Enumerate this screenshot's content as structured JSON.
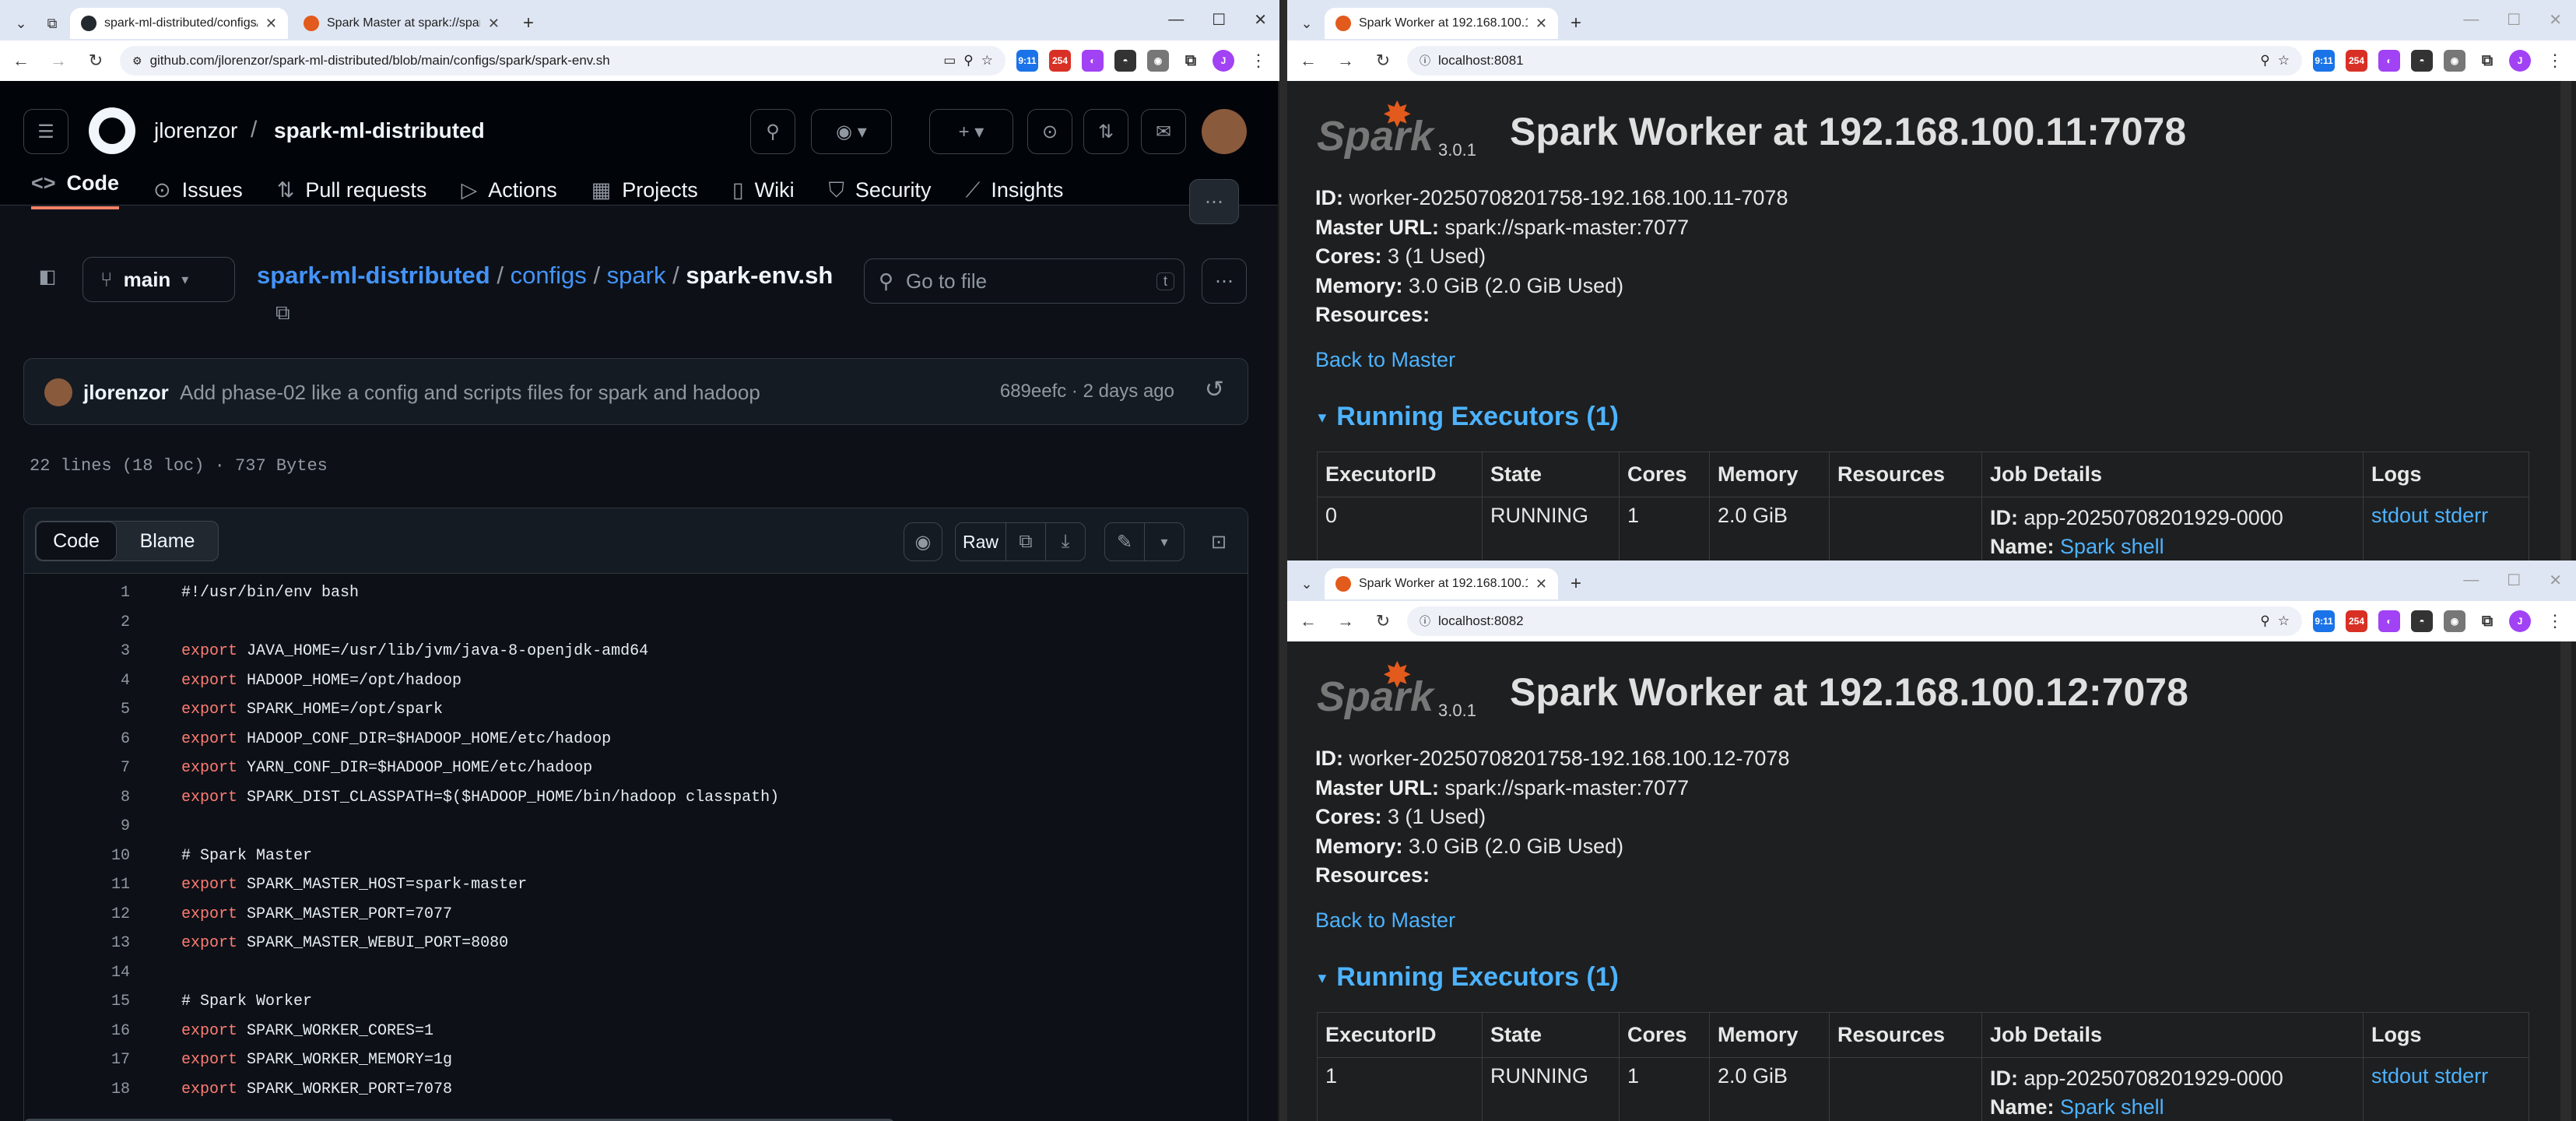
{
  "left_window": {
    "tabs": [
      {
        "title": "spark-ml-distributed/configs/sp",
        "active": true
      },
      {
        "title": "Spark Master at spark://spark-m",
        "active": false
      }
    ],
    "url": "github.com/jlorenzor/spark-ml-distributed/blob/main/configs/spark/spark-env.sh"
  },
  "github": {
    "owner": "jlorenzor",
    "repo": "spark-ml-distributed",
    "nav": [
      "Code",
      "Issues",
      "Pull requests",
      "Actions",
      "Projects",
      "Wiki",
      "Security",
      "Insights"
    ],
    "branch": "main",
    "breadcrumb": {
      "repo": "spark-ml-distributed",
      "dir1": "configs",
      "dir2": "spark",
      "file": "spark-env.sh"
    },
    "goto_placeholder": "Go to file",
    "goto_key": "t",
    "commit": {
      "author": "jlorenzor",
      "message": "Add phase-02 like a config and scripts files for spark and hadoop",
      "hash_time": "689eefc · 2 days ago"
    },
    "file_meta": "22 lines (18 loc) · 737 Bytes",
    "view_tabs": {
      "code": "Code",
      "blame": "Blame",
      "raw": "Raw"
    },
    "code_lines": [
      {
        "n": "1",
        "kw": "",
        "rest": "#!/usr/bin/env bash",
        "cls": "ct"
      },
      {
        "n": "2",
        "kw": "",
        "rest": "",
        "cls": "ct"
      },
      {
        "n": "3",
        "kw": "export",
        "rest": " JAVA_HOME=/usr/lib/jvm/java-8-openjdk-amd64",
        "cls": "ct"
      },
      {
        "n": "4",
        "kw": "export",
        "rest": " HADOOP_HOME=/opt/hadoop",
        "cls": "ct"
      },
      {
        "n": "5",
        "kw": "export",
        "rest": " SPARK_HOME=/opt/spark",
        "cls": "ct"
      },
      {
        "n": "6",
        "kw": "export",
        "rest": " HADOOP_CONF_DIR=$HADOOP_HOME/etc/hadoop",
        "cls": "ct"
      },
      {
        "n": "7",
        "kw": "export",
        "rest": " YARN_CONF_DIR=$HADOOP_HOME/etc/hadoop",
        "cls": "ct"
      },
      {
        "n": "8",
        "kw": "export",
        "rest": " SPARK_DIST_CLASSPATH=$($HADOOP_HOME/bin/hadoop classpath)",
        "cls": "ct"
      },
      {
        "n": "9",
        "kw": "",
        "rest": "",
        "cls": "ct"
      },
      {
        "n": "10",
        "kw": "",
        "rest": "# Spark Master",
        "cls": "ct cm"
      },
      {
        "n": "11",
        "kw": "export",
        "rest": " SPARK_MASTER_HOST=spark-master",
        "cls": "ct"
      },
      {
        "n": "12",
        "kw": "export",
        "rest": " SPARK_MASTER_PORT=7077",
        "cls": "ct"
      },
      {
        "n": "13",
        "kw": "export",
        "rest": " SPARK_MASTER_WEBUI_PORT=8080",
        "cls": "ct"
      },
      {
        "n": "14",
        "kw": "",
        "rest": "",
        "cls": "ct"
      },
      {
        "n": "15",
        "kw": "",
        "rest": "# Spark Worker",
        "cls": "ct cm"
      },
      {
        "n": "16",
        "kw": "export",
        "rest": " SPARK_WORKER_CORES=1",
        "cls": "ct"
      },
      {
        "n": "17",
        "kw": "export",
        "rest": " SPARK_WORKER_MEMORY=1g",
        "cls": "ct"
      },
      {
        "n": "18",
        "kw": "export",
        "rest": " SPARK_WORKER_PORT=7078",
        "cls": "ct"
      }
    ]
  },
  "workers": [
    {
      "tab_title": "Spark Worker at 192.168.100.1",
      "url": "localhost:8081",
      "spark_version": "3.0.1",
      "title": "Spark Worker at 192.168.100.11:7078",
      "id_label": "ID:",
      "id": " worker-20250708201758-192.168.100.11-7078",
      "master_label": "Master URL:",
      "master": " spark://spark-master:7077",
      "cores_label": "Cores:",
      "cores": " 3 (1 Used)",
      "memory_label": "Memory:",
      "memory": " 3.0 GiB (2.0 GiB Used)",
      "resources_label": "Resources:",
      "back": "Back to Master",
      "running": "Running Executors (1)",
      "headers": [
        "ExecutorID",
        "State",
        "Cores",
        "Memory",
        "Resources",
        "Job Details",
        "Logs"
      ],
      "row": {
        "id": "0",
        "state": "RUNNING",
        "cores": "1",
        "memory": "2.0 GiB",
        "resources": "",
        "job_id_label": "ID:",
        "job_id": " app-20250708201929-0000",
        "name_label": "Name:",
        "name": "Spark shell",
        "stdout": "stdout",
        "stderr": "stderr"
      }
    },
    {
      "tab_title": "Spark Worker at 192.168.100.1",
      "url": "localhost:8082",
      "spark_version": "3.0.1",
      "title": "Spark Worker at 192.168.100.12:7078",
      "id_label": "ID:",
      "id": " worker-20250708201758-192.168.100.12-7078",
      "master_label": "Master URL:",
      "master": " spark://spark-master:7077",
      "cores_label": "Cores:",
      "cores": " 3 (1 Used)",
      "memory_label": "Memory:",
      "memory": " 3.0 GiB (2.0 GiB Used)",
      "resources_label": "Resources:",
      "back": "Back to Master",
      "running": "Running Executors (1)",
      "headers": [
        "ExecutorID",
        "State",
        "Cores",
        "Memory",
        "Resources",
        "Job Details",
        "Logs"
      ],
      "row": {
        "id": "1",
        "state": "RUNNING",
        "cores": "1",
        "memory": "2.0 GiB",
        "resources": "",
        "job_id_label": "ID:",
        "job_id": " app-20250708201929-0000",
        "name_label": "Name:",
        "name": "Spark shell",
        "stdout": "stdout",
        "stderr": "stderr"
      }
    }
  ],
  "colors": {
    "github_bg": "#0d1117",
    "spark_link": "#4db3ff",
    "keyword": "#ff7b72",
    "chrome_frame": "#dfe6f3"
  },
  "extension_badges": {
    "cal": "9:11",
    "mail": "254"
  }
}
